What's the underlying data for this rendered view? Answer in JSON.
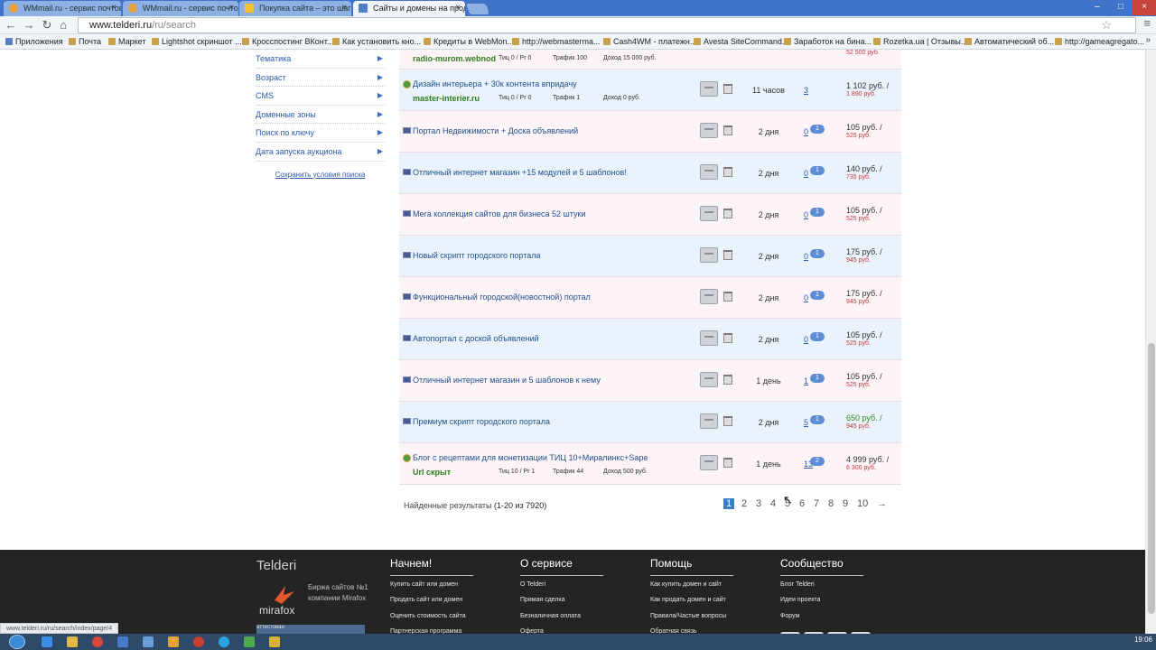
{
  "browser": {
    "tabs": [
      {
        "title": "WMmail.ru - сервис почтов",
        "active": false
      },
      {
        "title": "WMmail.ru - сервис почтов",
        "active": false
      },
      {
        "title": "Покупка сайта – это шаг в",
        "active": false
      },
      {
        "title": "Сайты и домены на прод",
        "active": true
      }
    ],
    "url_host": "www.telderi.ru",
    "url_path": "/ru/search",
    "bookmarks": [
      "Приложения",
      "Почта",
      "Маркет",
      "Lightshot скриншот ...",
      "Кросспостинг ВКонт...",
      "Как установить кно...",
      "Кредиты в WebMon...",
      "http://webmasterma...",
      "Cash4WM - платежн...",
      "Avesta SiteCommand...",
      "Заработок на бина...",
      "Rozetka.ua | Отзывы...",
      "Автоматический об...",
      "http://gameagregato..."
    ]
  },
  "sidebar": {
    "items": [
      "Тематика",
      "Возраст",
      "CMS",
      "Доменные зоны",
      "Поиск по ключу",
      "Дата запуска аукциона"
    ],
    "save_label": "Сохранить условия поиска"
  },
  "results": {
    "partial_row": {
      "domain": "radio-murom.webnod",
      "tic": "Тиц 0 / Pr 0",
      "traffic": "Трафик 100",
      "income": "Доход 15 000 руб.",
      "price_old": "52 500 руб."
    },
    "rows": [
      {
        "title": "Дизайн интерьера + 30к контента впридачу",
        "domain": "master-interier.ru",
        "tic": "Тиц 0 / Pr 0",
        "traffic": "Трафик 1",
        "income": "Доход 0 руб.",
        "age": "11 часов",
        "bids": "3",
        "bubble": "",
        "price": "1 102 руб. /",
        "price_old": "1 890 руб.",
        "kind": "globe",
        "green": false
      },
      {
        "title": "Портал Недвижимости + Доска объявлений",
        "domain": "",
        "age": "2 дня",
        "bids": "0",
        "bubble": "1",
        "price": "105 руб. /",
        "price_old": "525 руб.",
        "kind": "flag",
        "green": false
      },
      {
        "title": "Отличный интернет магазин +15 модулей и 5 шаблонов!",
        "domain": "",
        "age": "2 дня",
        "bids": "0",
        "bubble": "1",
        "price": "140 руб. /",
        "price_old": "735 руб.",
        "kind": "flag",
        "green": false
      },
      {
        "title": "Мега коллекция сайтов для бизнеса 52 штуки",
        "domain": "",
        "age": "2 дня",
        "bids": "0",
        "bubble": "1",
        "price": "105 руб. /",
        "price_old": "525 руб.",
        "kind": "flag",
        "green": false
      },
      {
        "title": "Новый скрипт городского портала",
        "domain": "",
        "age": "2 дня",
        "bids": "0",
        "bubble": "1",
        "price": "175 руб. /",
        "price_old": "945 руб.",
        "kind": "flag",
        "green": false
      },
      {
        "title": "Функциональный городской(новостной) портал",
        "domain": "",
        "age": "2 дня",
        "bids": "0",
        "bubble": "1",
        "price": "175 руб. /",
        "price_old": "945 руб.",
        "kind": "flag",
        "green": false
      },
      {
        "title": "Автопортал с доской объявлений",
        "domain": "",
        "age": "2 дня",
        "bids": "0",
        "bubble": "1",
        "price": "105 руб. /",
        "price_old": "525 руб.",
        "kind": "flag",
        "green": false
      },
      {
        "title": "Отличный интернет магазин и 5 шаблонов к нему",
        "domain": "",
        "age": "1 день",
        "bids": "1",
        "bubble": "1",
        "price": "105 руб. /",
        "price_old": "525 руб.",
        "kind": "flag",
        "green": false
      },
      {
        "title": "Премиум скрипт городского портала",
        "domain": "",
        "age": "2 дня",
        "bids": "5",
        "bubble": "1",
        "price": "650 руб. /",
        "price_old": "945 руб.",
        "kind": "flag",
        "green": true
      },
      {
        "title": "Блог с рецептами для монетизации ТИЦ 10+Миралинкс+Sape",
        "domain": "Url скрыт",
        "tic": "Тиц 10 / Pr 1",
        "traffic": "Трафик 44",
        "income": "Доход 500 руб.",
        "age": "1 день",
        "bids": "13",
        "bubble": "2",
        "price": "4 999 руб. /",
        "price_old": "6 300 руб.",
        "kind": "globe",
        "green": false
      }
    ],
    "found_prefix": "Найденные результаты ",
    "found_range": "(1-20 из 7920)",
    "pages": [
      "1",
      "2",
      "3",
      "4",
      "5",
      "6",
      "7",
      "8",
      "9",
      "10",
      "→"
    ]
  },
  "footer": {
    "brand": "Telderi",
    "desc_line1": "Биржа сайтов №1",
    "desc_line2": "компании Mirafox",
    "logo_text": "mirafox",
    "badge": "аттестован",
    "columns": [
      {
        "heading": "Начнем!",
        "links": [
          "Купить сайт или домен",
          "Продать сайт или домен",
          "Оценить стоимость сайта",
          "Партнерская программа"
        ]
      },
      {
        "heading": "О сервисе",
        "links": [
          "О Telderi",
          "Прямая сделка",
          "Безналичная оплата",
          "Оферта"
        ]
      },
      {
        "heading": "Помощь",
        "links": [
          "Как купить домен и сайт",
          "Как продать домен и сайт",
          "Правила/Частые вопросы",
          "Обратная связь"
        ]
      },
      {
        "heading": "Сообщество",
        "links": [
          "Блог Telderi",
          "Идеи проекта",
          "Форум"
        ]
      }
    ]
  },
  "status_url": "www.telderi.ru/ru/search/index/page/4",
  "taskbar": {
    "clock": "19:06"
  },
  "colors": {
    "accent": "#3a7fc4",
    "link": "#1f4f8c",
    "domain_green": "#2f7d1e",
    "price_red": "#c63a3a"
  }
}
